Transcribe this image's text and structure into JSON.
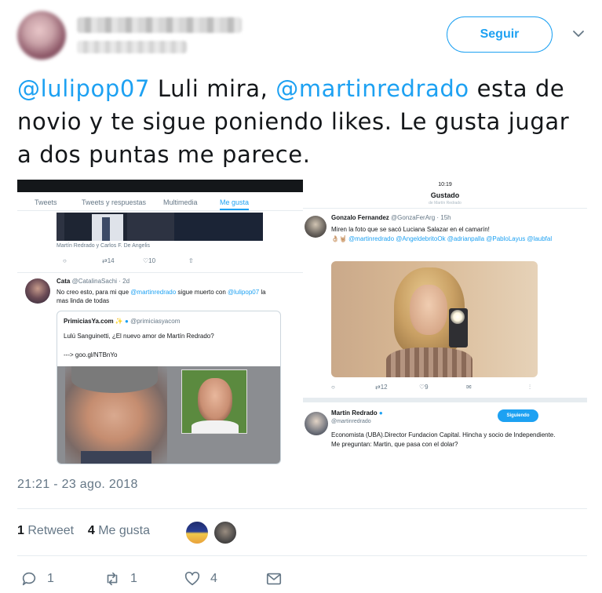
{
  "header": {
    "follow_label": "Seguir"
  },
  "tweet": {
    "mention1": "@lulipop07",
    "text1": " Luli mira, ",
    "mention2": "@martinredrado",
    "text2": " esta de novio y te sigue poniendo likes. Le gusta jugar a dos puntas me parece.",
    "timestamp": "21:21 - 23 ago. 2018"
  },
  "left_shot": {
    "tabs": [
      "Tweets",
      "Tweets y respuestas",
      "Multimedia",
      "Me gusta"
    ],
    "caption": "Martín Redrado y Carlos F. De Angelis",
    "mini_counts": [
      "14",
      "10"
    ],
    "cata_name": "Cata",
    "cata_handle": "@CatalinaSachi · 2d",
    "cata_text_a": "No creo esto, para mi que ",
    "cata_mention1": "@martinredrado",
    "cata_text_b": " sigue muerto con ",
    "cata_mention2": "@lulipop07",
    "cata_text_c": " la mas linda de todas",
    "quote_name": "PrimiciasYa.com",
    "quote_handle": "@primiciasyacom",
    "quote_text": "Lulú Sanguinetti, ¿El nuevo amor de Martín Redrado?",
    "quote_link": "---> goo.gl/NTBnYo"
  },
  "right_shot": {
    "time": "10:19",
    "title": "Gustado",
    "subtitle": "de Martín Redrado",
    "gz_name": "Gonzalo Fernandez",
    "gz_handle": "@GonzaFerArg · 15h",
    "gz_text": "Miren la foto que se sacó Luciana Salazar en el camarín!",
    "gz_mentions": "@martinredrado @AngeldebritoOk @adrianpalla @PabloLayus @laubfal",
    "gz_counts": [
      "12",
      "9"
    ],
    "mr_name": "Martín Redrado",
    "mr_handle": "@martinredrado",
    "mr_follow": "Siguiendo",
    "mr_bio": "Economista (UBA).Director Fundacion Capital. Hincha y socio de Independiente. Me preguntan: Martin, que pasa con el dolar?"
  },
  "stats": {
    "retweets_count": "1",
    "retweets_label": "Retweet",
    "likes_count": "4",
    "likes_label": "Me gusta"
  },
  "actions": {
    "reply_count": "1",
    "retweet_count": "1",
    "like_count": "4"
  },
  "colors": {
    "accent": "#1da1f2",
    "muted": "#657786",
    "text": "#14171a"
  }
}
